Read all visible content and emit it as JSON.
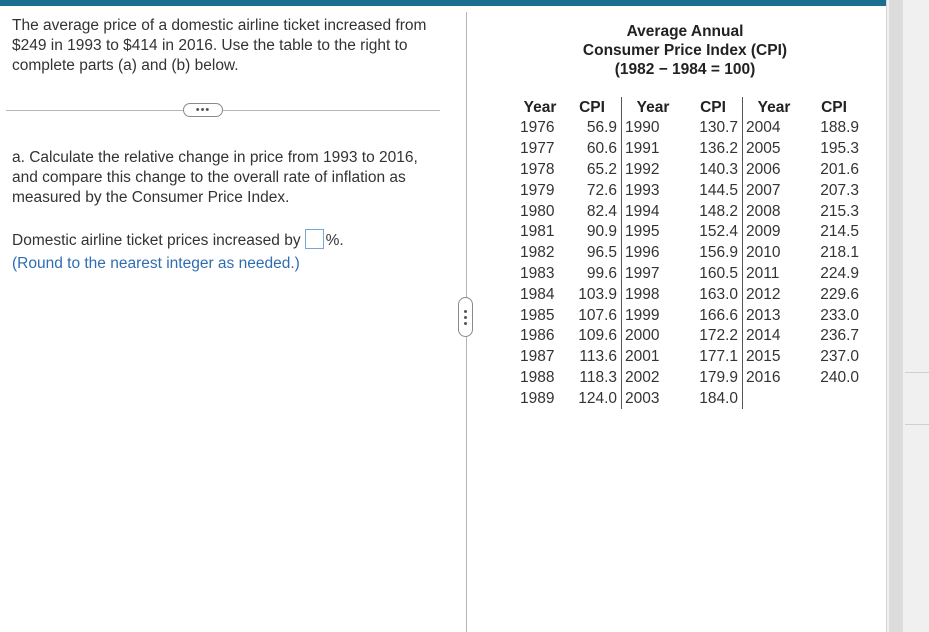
{
  "question": {
    "intro": "The average price of a domestic airline ticket increased from $249 in 1993 to $414 in 2016. Use the table to the right to complete parts (a) and (b) below.",
    "expand_label": "•••",
    "part_a": "a. Calculate the relative change in price from 1993 to 2016, and compare this change to the overall rate of inflation as measured by the Consumer Price Index.",
    "answer_prefix": "Domestic airline ticket prices increased by",
    "answer_value": "",
    "answer_suffix": "%.",
    "hint": "(Round to the nearest integer as needed.)"
  },
  "table": {
    "title_line1": "Average Annual",
    "title_line2": "Consumer Price Index (CPI)",
    "title_line3": "(1982 − 1984 = 100)",
    "headers": [
      "Year",
      "CPI",
      "Year",
      "CPI",
      "Year",
      "CPI"
    ],
    "rows": [
      [
        "1976",
        "56.9",
        "1990",
        "130.7",
        "2004",
        "188.9"
      ],
      [
        "1977",
        "60.6",
        "1991",
        "136.2",
        "2005",
        "195.3"
      ],
      [
        "1978",
        "65.2",
        "1992",
        "140.3",
        "2006",
        "201.6"
      ],
      [
        "1979",
        "72.6",
        "1993",
        "144.5",
        "2007",
        "207.3"
      ],
      [
        "1980",
        "82.4",
        "1994",
        "148.2",
        "2008",
        "215.3"
      ],
      [
        "1981",
        "90.9",
        "1995",
        "152.4",
        "2009",
        "214.5"
      ],
      [
        "1982",
        "96.5",
        "1996",
        "156.9",
        "2010",
        "218.1"
      ],
      [
        "1983",
        "99.6",
        "1997",
        "160.5",
        "2011",
        "224.9"
      ],
      [
        "1984",
        "103.9",
        "1998",
        "163.0",
        "2012",
        "229.6"
      ],
      [
        "1985",
        "107.6",
        "1999",
        "166.6",
        "2013",
        "233.0"
      ],
      [
        "1986",
        "109.6",
        "2000",
        "172.2",
        "2014",
        "236.7"
      ],
      [
        "1987",
        "113.6",
        "2001",
        "177.1",
        "2015",
        "237.0"
      ],
      [
        "1988",
        "118.3",
        "2002",
        "179.9",
        "2016",
        "240.0"
      ],
      [
        "1989",
        "124.0",
        "2003",
        "184.0",
        "",
        ""
      ]
    ]
  },
  "colors": {
    "accent_bar": "#1a6f8f",
    "hint_text": "#2e6db4",
    "answer_box_border": "#7aa6d6"
  },
  "icons": {
    "expand": "ellipsis-icon",
    "splitter": "vertical-ellipsis-icon"
  }
}
